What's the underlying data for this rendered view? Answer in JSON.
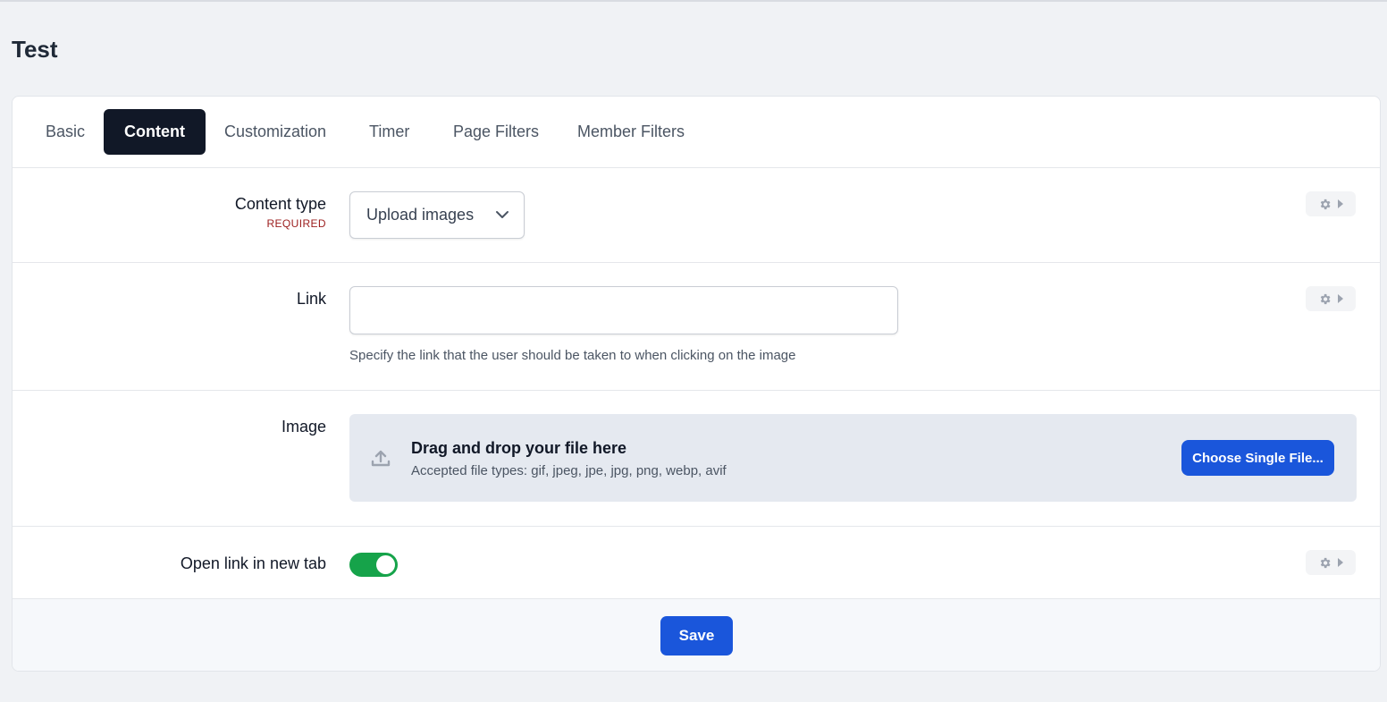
{
  "page": {
    "title": "Test"
  },
  "tabs": [
    {
      "label": "Basic"
    },
    {
      "label": "Content",
      "active": true
    },
    {
      "label": "Customization"
    },
    {
      "label": "Timer"
    },
    {
      "label": "Page Filters"
    },
    {
      "label": "Member Filters"
    }
  ],
  "fields": {
    "content_type": {
      "label": "Content type",
      "required_text": "REQUIRED",
      "value": "Upload images"
    },
    "link": {
      "label": "Link",
      "value": "",
      "helper": "Specify the link that the user should be taken to when clicking on the image"
    },
    "image": {
      "label": "Image",
      "dropzone_title": "Drag and drop your file here",
      "dropzone_subtitle": "Accepted file types: gif, jpeg, jpe, jpg, png, webp, avif",
      "button_label": "Choose Single File..."
    },
    "open_new_tab": {
      "label": "Open link in new tab",
      "on": true
    }
  },
  "footer": {
    "save_label": "Save"
  },
  "colors": {
    "primary": "#1a56db",
    "active_tab": "#111827",
    "toggle_on": "#16a34a",
    "required": "#9b1c1c"
  },
  "icons": {
    "select_arrow": "chevron-down-icon",
    "settings": "gear-icon",
    "expand": "caret-right-icon",
    "upload": "upload-icon"
  }
}
